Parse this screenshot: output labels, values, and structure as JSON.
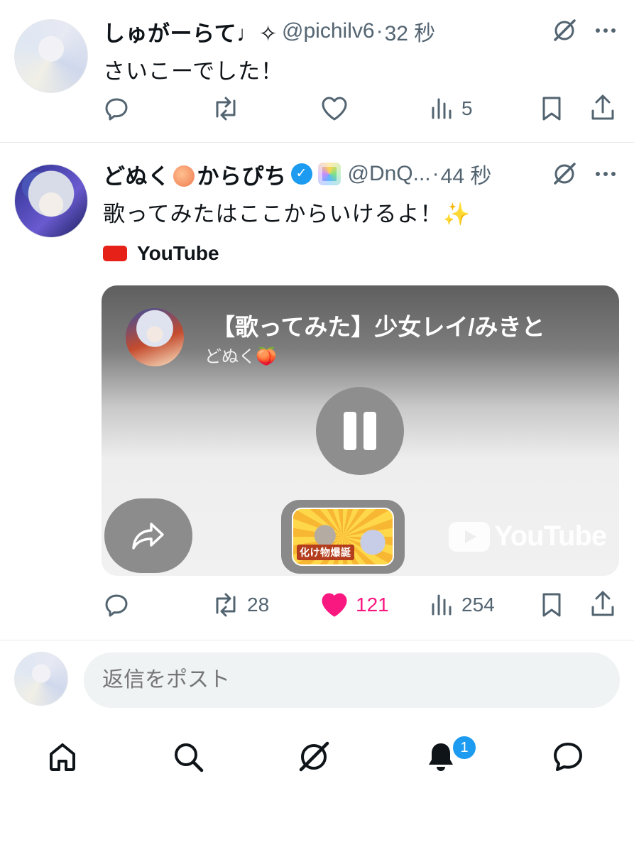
{
  "tweets": [
    {
      "display_name": "しゅがーらて♩✧",
      "handle": "@pichilv6",
      "separator": "·",
      "time": "32 秒",
      "text": "さいこーでした！",
      "actions": {
        "replies": "",
        "reposts": "",
        "likes": "",
        "views": "5"
      },
      "liked": false
    },
    {
      "display_name_prefix": "どぬく",
      "display_name_suffix": "からぴち",
      "verified": true,
      "handle": "@DnQ...",
      "separator": "·",
      "time": "44 秒",
      "text": "歌ってみたはここからいけるよ！✨",
      "actions": {
        "replies": "",
        "reposts": "28",
        "likes": "121",
        "views": "254"
      },
      "liked": true,
      "link_source": "YouTube",
      "video_card": {
        "title": "【歌ってみた】少女レイ/みきと",
        "channel": "どぬく🍑",
        "thumbnail_caption": "化け物爆誕",
        "watermark": "YouTube"
      }
    }
  ],
  "reply": {
    "placeholder": "返信をポスト"
  },
  "tab_bar": {
    "items": [
      "home",
      "search",
      "grok",
      "notifications",
      "messages"
    ],
    "notification_badge": "1"
  },
  "colors": {
    "accent": "#1d9bf0",
    "like": "#f91880",
    "youtube_red": "#e62117",
    "secondary_text": "#536471"
  }
}
